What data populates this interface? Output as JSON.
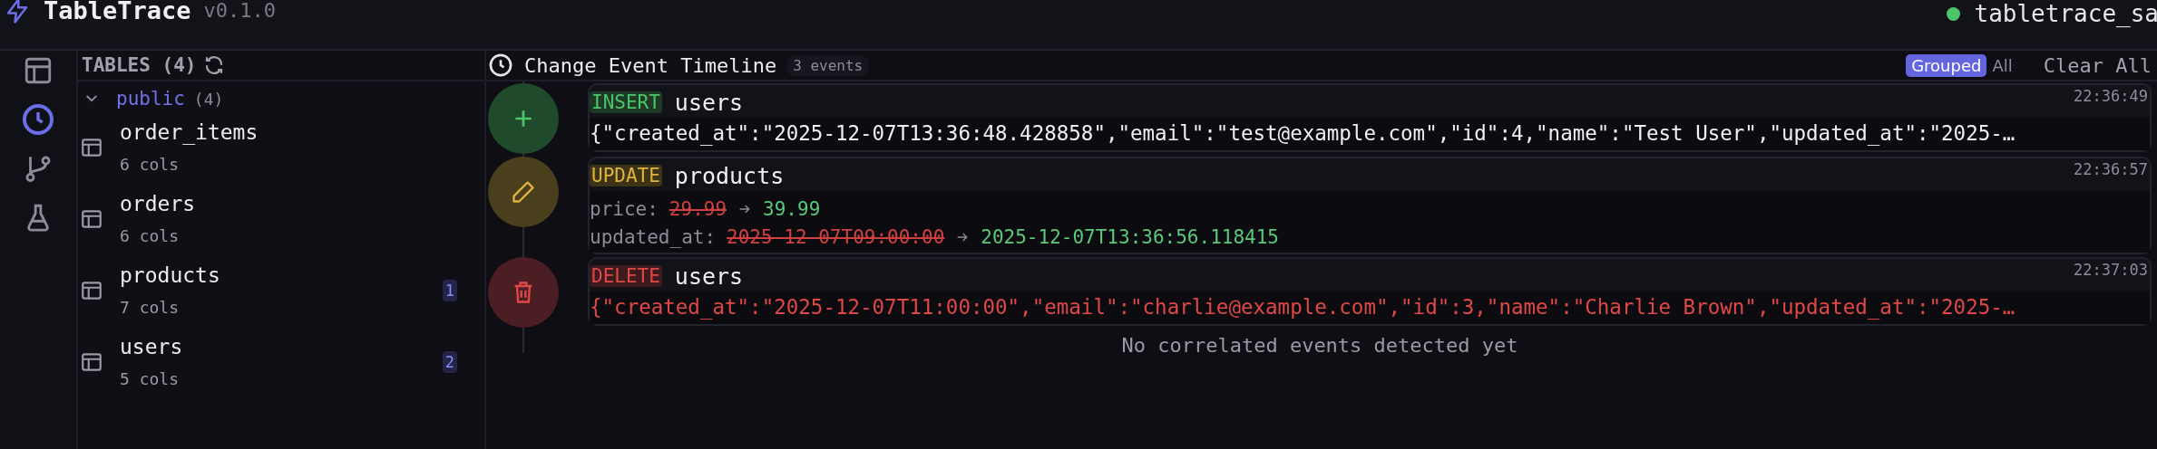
{
  "header": {
    "app_name": "TableTrace",
    "version": "v0.1.0",
    "connection": {
      "name": "tabletrace_sa",
      "connected": true
    }
  },
  "rail": [
    {
      "kind": "tables",
      "selected": false
    },
    {
      "kind": "timeline",
      "selected": true
    },
    {
      "kind": "branches",
      "selected": false
    },
    {
      "kind": "lab",
      "selected": false
    }
  ],
  "tables_panel": {
    "title": "TABLES (4)",
    "schemas": [
      {
        "name": "public",
        "count": "(4)",
        "expanded": true,
        "children": [
          {
            "name": "order_items",
            "cols": "6 cols"
          },
          {
            "name": "orders",
            "cols": "6 cols"
          },
          {
            "name": "products",
            "cols": "7 cols",
            "badge": "1"
          },
          {
            "name": "users",
            "cols": "5 cols",
            "badge": "2"
          }
        ]
      }
    ]
  },
  "timeline": {
    "title": "Change Event Timeline",
    "count": "3 events",
    "view_options": [
      {
        "label": "Grouped",
        "selected": true
      },
      {
        "label": "All",
        "selected": false
      }
    ],
    "clear_label": "Clear All",
    "events": [
      {
        "kind": "insert",
        "op": "INSERT",
        "table": "users",
        "time": "22:36:49",
        "body": "{\"created_at\":\"2025-12-07T13:36:48.428858\",\"email\":\"test@example.com\",\"id\":4,\"name\":\"Test User\",\"updated_at\":\"2025-…"
      },
      {
        "kind": "update",
        "op": "UPDATE",
        "table": "products",
        "time": "22:36:57",
        "changes": [
          {
            "field": "price:",
            "old": "29.99",
            "new": "39.99"
          },
          {
            "field": "updated_at:",
            "old": "2025-12-07T09:00:00",
            "new": "2025-12-07T13:36:56.118415"
          }
        ]
      },
      {
        "kind": "delete",
        "op": "DELETE",
        "table": "users",
        "time": "22:37:03",
        "body": "{\"created_at\":\"2025-12-07T11:00:00\",\"email\":\"charlie@example.com\",\"id\":3,\"name\":\"Charlie Brown\",\"updated_at\":\"2025-…"
      }
    ],
    "empty_message": "No correlated events detected yet"
  }
}
